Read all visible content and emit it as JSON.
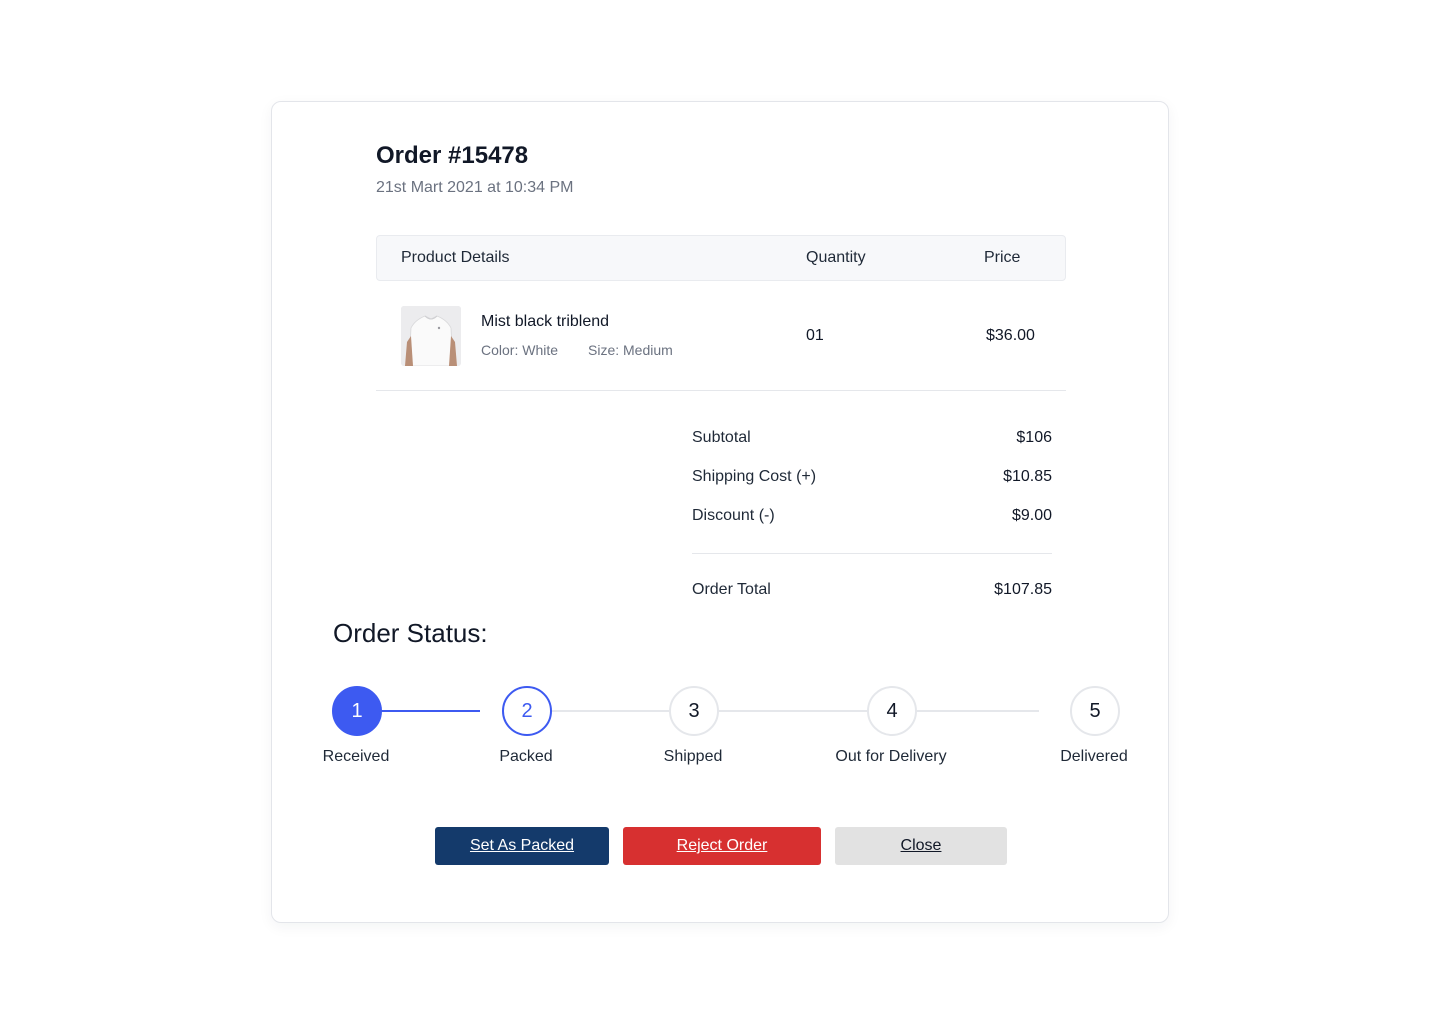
{
  "order": {
    "title": "Order #15478",
    "date": "21st Mart 2021 at 10:34 PM"
  },
  "table": {
    "headers": {
      "product": "Product Details",
      "quantity": "Quantity",
      "price": "Price"
    },
    "rows": [
      {
        "name": "Mist black triblend",
        "color": "Color: White",
        "size": "Size: Medium",
        "quantity": "01",
        "price": "$36.00"
      }
    ]
  },
  "summary": {
    "subtotal_label": "Subtotal",
    "subtotal_value": "$106",
    "shipping_label": "Shipping Cost (+)",
    "shipping_value": "$10.85",
    "discount_label": "Discount (-)",
    "discount_value": "$9.00",
    "total_label": "Order Total",
    "total_value": "$107.85"
  },
  "status": {
    "title": "Order Status:",
    "steps": [
      {
        "number": "1",
        "label": "Received",
        "state": "done"
      },
      {
        "number": "2",
        "label": "Packed",
        "state": "current"
      },
      {
        "number": "3",
        "label": "Shipped",
        "state": "pending"
      },
      {
        "number": "4",
        "label": "Out for Delivery",
        "state": "pending"
      },
      {
        "number": "5",
        "label": "Delivered",
        "state": "pending"
      }
    ]
  },
  "actions": {
    "set_packed": "Set As Packed",
    "reject": "Reject Order",
    "close": "Close"
  },
  "colors": {
    "accent": "#3d5af1",
    "primary_button": "#143a6b",
    "danger_button": "#d73030",
    "neutral_button": "#e2e2e2"
  }
}
